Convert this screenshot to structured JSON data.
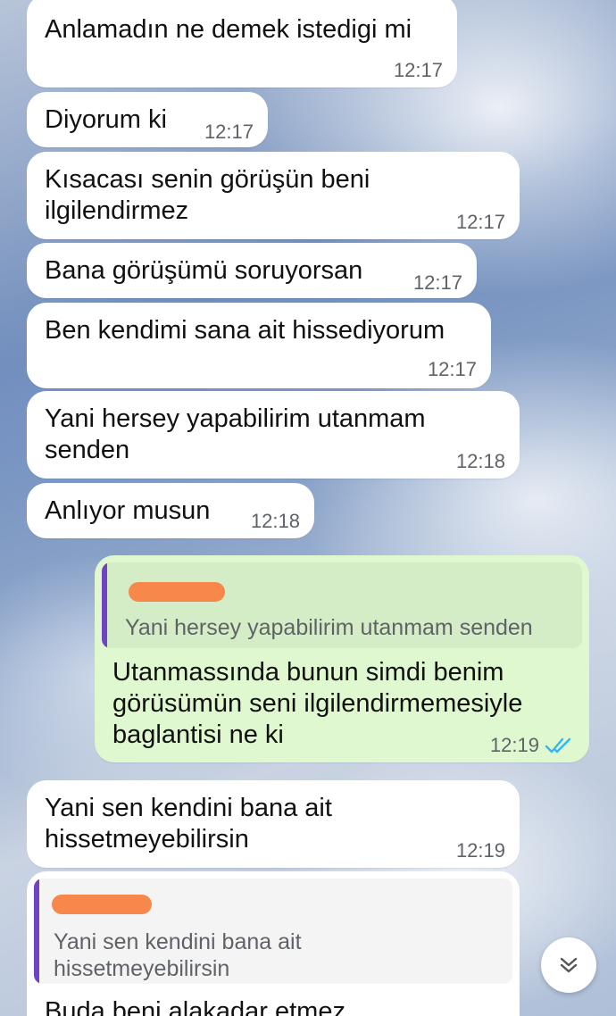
{
  "messages": [
    {
      "text": "Anlamadın ne demek istedigi mi",
      "time": "12:17"
    },
    {
      "text": "Diyorum ki",
      "time": "12:17"
    },
    {
      "text": "Kısacası senin görüşün beni\nilgilendirmez",
      "time": "12:17"
    },
    {
      "text": "Bana görüşümü soruyorsan",
      "time": "12:17"
    },
    {
      "text": "Ben kendimi sana ait hissediyorum",
      "time": "12:17"
    },
    {
      "text": "Yani hersey yapabilirim utanmam\nsenden",
      "time": "12:18"
    },
    {
      "text": "Anlıyor musun",
      "time": "12:18"
    },
    {
      "quote": "Yani hersey yapabilirim utanmam senden",
      "text": "Utanmassında bunun simdi benim\ngörüsümün seni ilgilendirmemesiyle\nbaglantisi ne ki",
      "time": "12:19"
    },
    {
      "text": "Yani sen kendini bana ait\nhissetmeyebilirsin",
      "time": "12:19"
    },
    {
      "quote": "Yani sen kendini bana ait\nhissetmeyebilirsin",
      "text": "Buda beni alakadar etmez"
    }
  ],
  "colors": {
    "incoming_bubble": "#ffffff",
    "outgoing_bubble": "#dff8cf",
    "quote_bar": "#6e44c2",
    "read_ticks": "#34b7f1",
    "redaction": "#f7874a"
  },
  "icons": {
    "read_receipt": "double-check-icon",
    "scroll_down": "double-chevron-down-icon"
  }
}
